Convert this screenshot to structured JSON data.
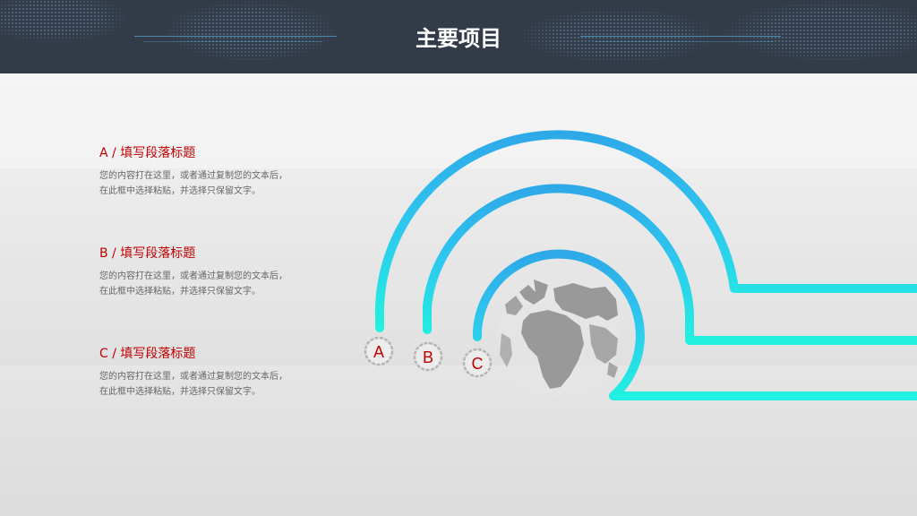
{
  "header": {
    "title": "主要项目"
  },
  "items": [
    {
      "letter": "A",
      "heading": "A / 填写段落标题",
      "line1": "您的内容打在这里，或者通过复制您的文本后，",
      "line2": "在此框中选择粘贴，并选择只保留文字。"
    },
    {
      "letter": "B",
      "heading": "B / 填写段落标题",
      "line1": "您的内容打在这里，或者通过复制您的文本后，",
      "line2": "在此框中选择粘贴，并选择只保留文字。"
    },
    {
      "letter": "C",
      "heading": "C / 填写段落标题",
      "line1": "您的内容打在这里，或者通过复制您的文本后，",
      "line2": "在此框中选择粘贴，并选择只保留文字。"
    }
  ],
  "colors": {
    "header_bg": "#333b48",
    "heading_red": "#c00000",
    "arc_blue": "#2ea9e8",
    "arc_cyan": "#22f0e0",
    "globe_gray": "#999999"
  },
  "icons": [
    "globe-icon",
    "letter-badge-a",
    "letter-badge-b",
    "letter-badge-c"
  ]
}
